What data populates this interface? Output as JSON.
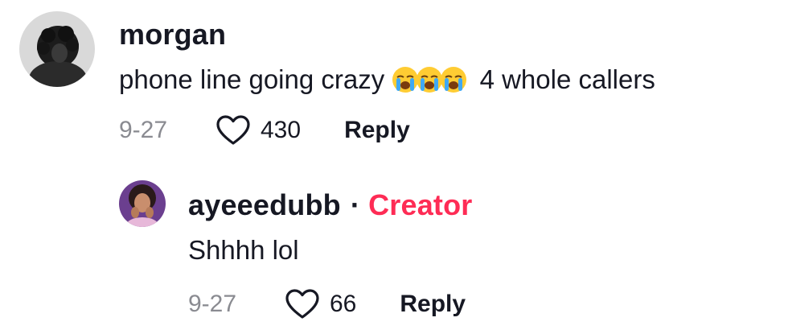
{
  "comment": {
    "username": "morgan",
    "text_before": "phone line going crazy",
    "emoji": [
      "loudly-crying-face-emoji",
      "loudly-crying-face-emoji",
      "loudly-crying-face-emoji"
    ],
    "text_after": "4 whole callers",
    "date": "9-27",
    "likes": "430",
    "reply_label": "Reply"
  },
  "reply": {
    "username": "ayeeedubb",
    "separator": "·",
    "badge": "Creator",
    "text": "Shhhh lol",
    "date": "9-27",
    "likes": "66",
    "reply_label": "Reply"
  },
  "colors": {
    "creator_badge": "#fe2c55",
    "date_gray": "#8a8b91",
    "text": "#161823"
  },
  "icons": {
    "like": "heart-outline-icon"
  }
}
